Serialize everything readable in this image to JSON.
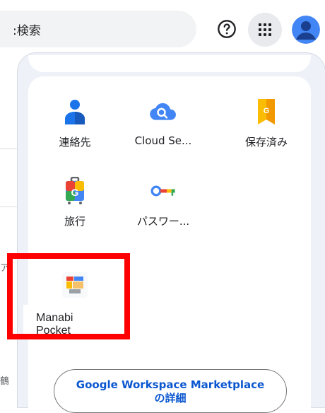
{
  "search": {
    "text": "検索",
    "prefix": ":"
  },
  "header": {
    "help_icon": "help-icon",
    "apps_icon": "apps-grid-icon",
    "avatar_icon": "account-avatar-icon"
  },
  "background": {
    "char1": "ア",
    "char2": "鶴"
  },
  "apps": [
    {
      "label": "連絡先",
      "icon": "contacts-icon"
    },
    {
      "label": "Cloud Se...",
      "icon": "cloud-search-icon"
    },
    {
      "label": "保存済み",
      "icon": "saved-icon"
    },
    {
      "label": "旅行",
      "icon": "travel-icon"
    },
    {
      "label": "パスワー...",
      "icon": "password-manager-icon"
    },
    {
      "label": "Manabi Pocket",
      "icon": "manabi-pocket-icon"
    }
  ],
  "marketplace": {
    "line1": "Google Workspace Marketplace",
    "line2": "の詳細"
  },
  "colors": {
    "highlight": "#ff0000",
    "link": "#0b57d0",
    "google_blue": "#4285f4",
    "google_red": "#ea4335",
    "google_yellow": "#fbbc04",
    "google_green": "#34a853"
  }
}
